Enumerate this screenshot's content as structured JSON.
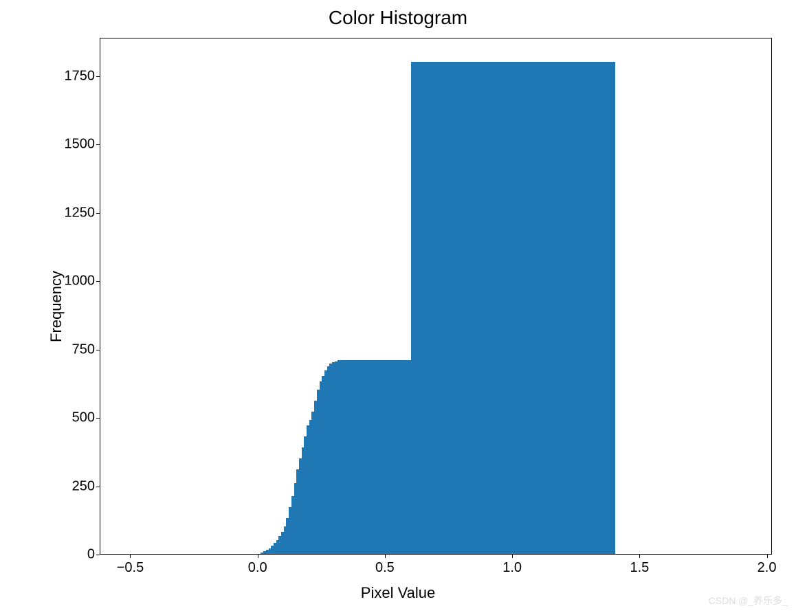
{
  "chart_data": {
    "type": "bar",
    "title": "Color Histogram",
    "xlabel": "Pixel Value",
    "ylabel": "Frequency",
    "xlim": [
      -0.62,
      2.02
    ],
    "ylim": [
      0,
      1890
    ],
    "xticks": [
      -0.5,
      0.0,
      0.5,
      1.0,
      1.5,
      2.0
    ],
    "xtick_labels": [
      "−0.5",
      "0.0",
      "0.5",
      "1.0",
      "1.5",
      "2.0"
    ],
    "yticks": [
      0,
      250,
      500,
      750,
      1000,
      1250,
      1500,
      1750
    ],
    "ytick_labels": [
      "0",
      "250",
      "500",
      "750",
      "1000",
      "1250",
      "1500",
      "1750"
    ],
    "bar_color": "#1f77b4",
    "bin_width": 0.01,
    "bins": [
      {
        "x": 0.0,
        "y": 0
      },
      {
        "x": 0.01,
        "y": 5
      },
      {
        "x": 0.02,
        "y": 10
      },
      {
        "x": 0.03,
        "y": 15
      },
      {
        "x": 0.04,
        "y": 20
      },
      {
        "x": 0.05,
        "y": 30
      },
      {
        "x": 0.06,
        "y": 40
      },
      {
        "x": 0.07,
        "y": 50
      },
      {
        "x": 0.08,
        "y": 65
      },
      {
        "x": 0.09,
        "y": 80
      },
      {
        "x": 0.1,
        "y": 100
      },
      {
        "x": 0.11,
        "y": 130
      },
      {
        "x": 0.12,
        "y": 170
      },
      {
        "x": 0.13,
        "y": 210
      },
      {
        "x": 0.14,
        "y": 260
      },
      {
        "x": 0.15,
        "y": 310
      },
      {
        "x": 0.16,
        "y": 350
      },
      {
        "x": 0.17,
        "y": 390
      },
      {
        "x": 0.18,
        "y": 430
      },
      {
        "x": 0.19,
        "y": 470
      },
      {
        "x": 0.2,
        "y": 490
      },
      {
        "x": 0.21,
        "y": 520
      },
      {
        "x": 0.22,
        "y": 560
      },
      {
        "x": 0.23,
        "y": 600
      },
      {
        "x": 0.24,
        "y": 630
      },
      {
        "x": 0.25,
        "y": 650
      },
      {
        "x": 0.26,
        "y": 670
      },
      {
        "x": 0.27,
        "y": 685
      },
      {
        "x": 0.28,
        "y": 695
      },
      {
        "x": 0.29,
        "y": 700
      },
      {
        "x": 0.3,
        "y": 705
      },
      {
        "x": 0.31,
        "y": 708
      },
      {
        "x": 0.32,
        "y": 710
      },
      {
        "x": 0.33,
        "y": 710
      },
      {
        "x": 0.34,
        "y": 710
      },
      {
        "x": 0.35,
        "y": 710
      },
      {
        "x": 0.36,
        "y": 710
      },
      {
        "x": 0.37,
        "y": 710
      },
      {
        "x": 0.38,
        "y": 710
      },
      {
        "x": 0.39,
        "y": 710
      },
      {
        "x": 0.4,
        "y": 710
      },
      {
        "x": 0.41,
        "y": 710
      },
      {
        "x": 0.42,
        "y": 710
      },
      {
        "x": 0.43,
        "y": 710
      },
      {
        "x": 0.44,
        "y": 710
      },
      {
        "x": 0.45,
        "y": 710
      },
      {
        "x": 0.46,
        "y": 710
      },
      {
        "x": 0.47,
        "y": 710
      },
      {
        "x": 0.48,
        "y": 710
      },
      {
        "x": 0.49,
        "y": 710
      },
      {
        "x": 0.5,
        "y": 710
      },
      {
        "x": 0.51,
        "y": 710
      },
      {
        "x": 0.52,
        "y": 710
      },
      {
        "x": 0.53,
        "y": 710
      },
      {
        "x": 0.54,
        "y": 710
      },
      {
        "x": 0.55,
        "y": 710
      },
      {
        "x": 0.56,
        "y": 710
      },
      {
        "x": 0.57,
        "y": 710
      },
      {
        "x": 0.58,
        "y": 710
      },
      {
        "x": 0.59,
        "y": 710
      },
      {
        "x": 0.6,
        "y": 1800
      },
      {
        "x": 0.61,
        "y": 1800
      },
      {
        "x": 0.62,
        "y": 1800
      },
      {
        "x": 0.63,
        "y": 1800
      },
      {
        "x": 0.64,
        "y": 1800
      },
      {
        "x": 0.65,
        "y": 1800
      },
      {
        "x": 0.66,
        "y": 1800
      },
      {
        "x": 0.67,
        "y": 1800
      },
      {
        "x": 0.68,
        "y": 1800
      },
      {
        "x": 0.69,
        "y": 1800
      },
      {
        "x": 0.7,
        "y": 1800
      },
      {
        "x": 0.71,
        "y": 1800
      },
      {
        "x": 0.72,
        "y": 1800
      },
      {
        "x": 0.73,
        "y": 1800
      },
      {
        "x": 0.74,
        "y": 1800
      },
      {
        "x": 0.75,
        "y": 1800
      },
      {
        "x": 0.76,
        "y": 1800
      },
      {
        "x": 0.77,
        "y": 1800
      },
      {
        "x": 0.78,
        "y": 1800
      },
      {
        "x": 0.79,
        "y": 1800
      },
      {
        "x": 0.8,
        "y": 1800
      },
      {
        "x": 0.81,
        "y": 1800
      },
      {
        "x": 0.82,
        "y": 1800
      },
      {
        "x": 0.83,
        "y": 1800
      },
      {
        "x": 0.84,
        "y": 1800
      },
      {
        "x": 0.85,
        "y": 1800
      },
      {
        "x": 0.86,
        "y": 1800
      },
      {
        "x": 0.87,
        "y": 1800
      },
      {
        "x": 0.88,
        "y": 1800
      },
      {
        "x": 0.89,
        "y": 1800
      },
      {
        "x": 0.9,
        "y": 1800
      },
      {
        "x": 0.91,
        "y": 1800
      },
      {
        "x": 0.92,
        "y": 1800
      },
      {
        "x": 0.93,
        "y": 1800
      },
      {
        "x": 0.94,
        "y": 1800
      },
      {
        "x": 0.95,
        "y": 1800
      },
      {
        "x": 0.96,
        "y": 1800
      },
      {
        "x": 0.97,
        "y": 1800
      },
      {
        "x": 0.98,
        "y": 1800
      },
      {
        "x": 0.99,
        "y": 1800
      },
      {
        "x": 1.0,
        "y": 1800
      },
      {
        "x": 1.01,
        "y": 1800
      },
      {
        "x": 1.02,
        "y": 1800
      },
      {
        "x": 1.03,
        "y": 1800
      },
      {
        "x": 1.04,
        "y": 1800
      },
      {
        "x": 1.05,
        "y": 1800
      },
      {
        "x": 1.06,
        "y": 1800
      },
      {
        "x": 1.07,
        "y": 1800
      },
      {
        "x": 1.08,
        "y": 1800
      },
      {
        "x": 1.09,
        "y": 1800
      },
      {
        "x": 1.1,
        "y": 1800
      },
      {
        "x": 1.11,
        "y": 1800
      },
      {
        "x": 1.12,
        "y": 1800
      },
      {
        "x": 1.13,
        "y": 1800
      },
      {
        "x": 1.14,
        "y": 1800
      },
      {
        "x": 1.15,
        "y": 1800
      },
      {
        "x": 1.16,
        "y": 1800
      },
      {
        "x": 1.17,
        "y": 1800
      },
      {
        "x": 1.18,
        "y": 1800
      },
      {
        "x": 1.19,
        "y": 1800
      },
      {
        "x": 1.2,
        "y": 1800
      },
      {
        "x": 1.21,
        "y": 1800
      },
      {
        "x": 1.22,
        "y": 1800
      },
      {
        "x": 1.23,
        "y": 1800
      },
      {
        "x": 1.24,
        "y": 1800
      },
      {
        "x": 1.25,
        "y": 1800
      },
      {
        "x": 1.26,
        "y": 1800
      },
      {
        "x": 1.27,
        "y": 1800
      },
      {
        "x": 1.28,
        "y": 1800
      },
      {
        "x": 1.29,
        "y": 1800
      },
      {
        "x": 1.3,
        "y": 1800
      },
      {
        "x": 1.31,
        "y": 1800
      },
      {
        "x": 1.32,
        "y": 1800
      },
      {
        "x": 1.33,
        "y": 1800
      },
      {
        "x": 1.34,
        "y": 1800
      },
      {
        "x": 1.35,
        "y": 1800
      },
      {
        "x": 1.36,
        "y": 1800
      },
      {
        "x": 1.37,
        "y": 1800
      },
      {
        "x": 1.38,
        "y": 1800
      },
      {
        "x": 1.39,
        "y": 1800
      }
    ]
  },
  "watermark": "CSDN @_养乐多_"
}
